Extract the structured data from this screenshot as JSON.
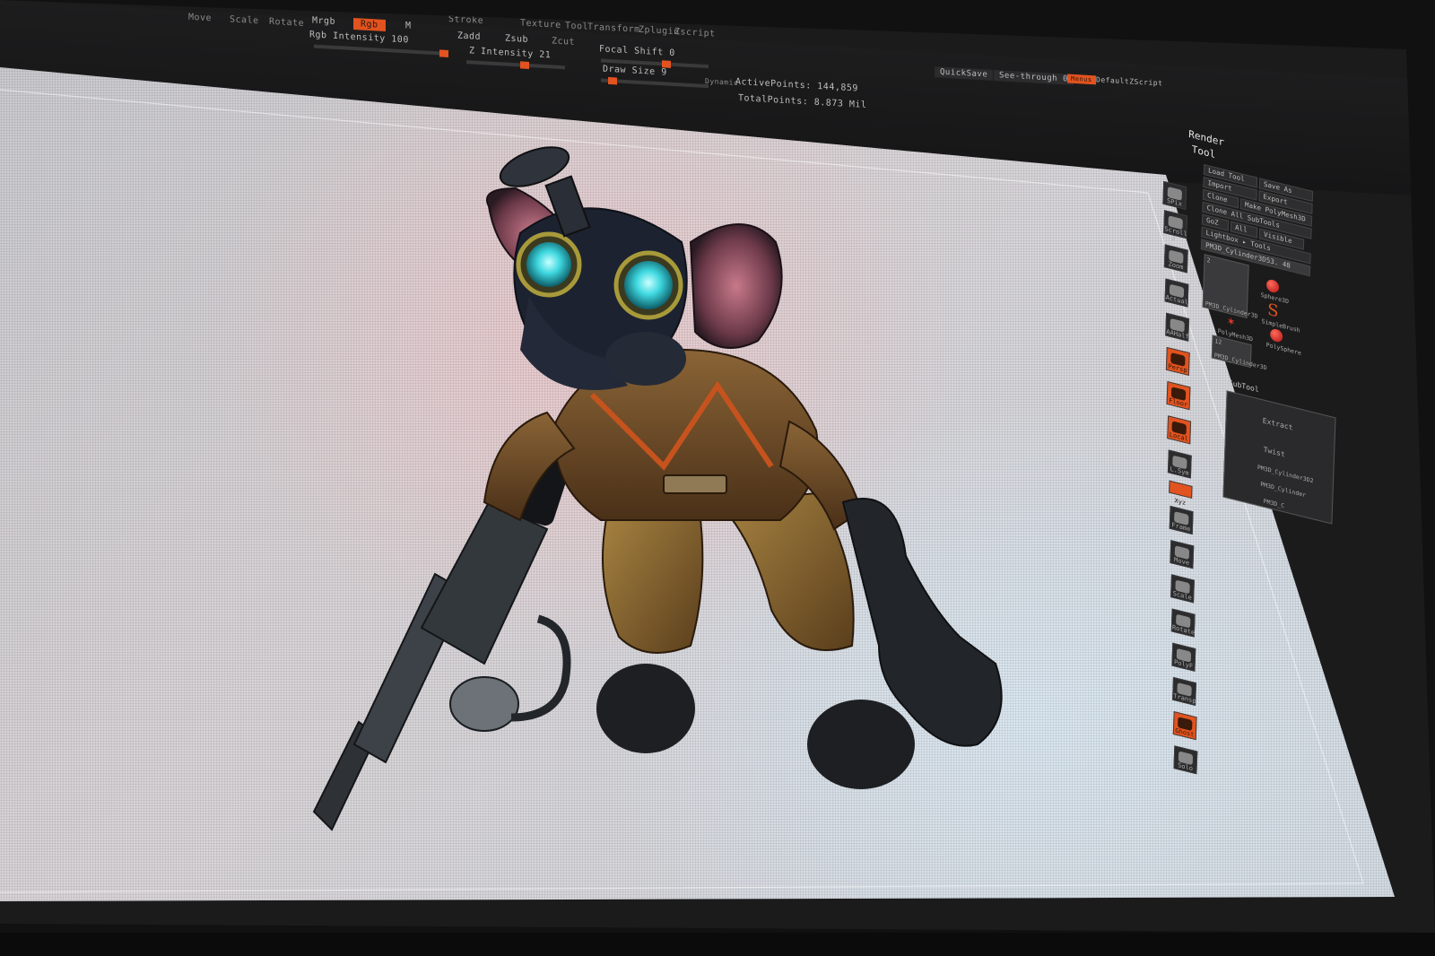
{
  "toolbar": {
    "row1": [
      "Move",
      "Scale",
      "Rotate",
      "Mrgb",
      "Rgb",
      "M"
    ],
    "rgb_intensity": "Rgb Intensity 100",
    "menus": [
      "Stroke",
      "Texture",
      "Tool",
      "Transform",
      "Zplugin",
      "Zscript"
    ],
    "zadd": "Zadd",
    "zsub": "Zsub",
    "zcut": "Zcut",
    "z_intensity": "Z Intensity 21",
    "focal_shift": "Focal Shift 0",
    "draw_size": "Draw Size 9",
    "dynamic": "Dynamic",
    "active_points": "ActivePoints: 144,859",
    "total_points": "TotalPoints: 8.873 Mil",
    "quicksave": "QuickSave",
    "see_through": "See-through 0",
    "menus_btn": "Menus",
    "default_zscript": "DefaultZScript"
  },
  "shelf": [
    {
      "label": "SPix 3",
      "icon": "bpr-sphere-icon",
      "active": false
    },
    {
      "label": "Scroll",
      "icon": "scroll-icon",
      "active": false
    },
    {
      "label": "Zoom",
      "icon": "zoom-icon",
      "active": false
    },
    {
      "label": "Actual",
      "icon": "actual-icon",
      "active": false
    },
    {
      "label": "AAHalf",
      "icon": "aahalf-icon",
      "active": false
    },
    {
      "label": "Persp",
      "icon": "perspective-icon",
      "active": true
    },
    {
      "label": "Floor",
      "icon": "floor-icon",
      "active": true
    },
    {
      "label": "Local",
      "icon": "local-icon",
      "active": true
    },
    {
      "label": "L.Sym",
      "icon": "local-symmetry-icon",
      "active": false
    },
    {
      "label": "Xyz",
      "icon": "xyz-icon",
      "active": true
    },
    {
      "label": "Frame",
      "icon": "frame-icon",
      "active": false
    },
    {
      "label": "Move",
      "icon": "move-icon",
      "active": false
    },
    {
      "label": "Scale",
      "icon": "scale-icon",
      "active": false
    },
    {
      "label": "Rotate",
      "icon": "rotate-icon",
      "active": false
    },
    {
      "label": "PolyF",
      "icon": "polyframe-icon",
      "active": false
    },
    {
      "label": "Transp",
      "icon": "transparency-icon",
      "active": false
    },
    {
      "label": "Ghost",
      "icon": "ghost-icon",
      "active": false
    },
    {
      "label": "Solo",
      "icon": "solo-icon",
      "active": false
    }
  ],
  "tool_palette": {
    "render_title": "Render",
    "tool_title": "Tool",
    "load_tool": "Load Tool",
    "save_as": "Save As",
    "import": "Import",
    "export": "Export",
    "clone": "Clone",
    "make_polymesh": "Make PolyMesh3D",
    "clone_all": "Clone All SubTools",
    "goz": "GoZ",
    "all": "All",
    "visible": "Visible",
    "lightbox_tools": "Lightbox ▸ Tools",
    "current_tool": "PM3D_Cylinder3D53. 48",
    "tool_count": "2",
    "tool_count_2": "12",
    "tools": [
      "PM3D_Cylinder3D",
      "Sphere3D",
      "SimpleBrush",
      "PolyMesh3D",
      "PolySphere",
      "PM3D_Cylinder3D"
    ],
    "subtool_title": "SubTool",
    "extract": "Extract",
    "twist": "Twist",
    "subtools": [
      "PM3D_Cylinder3D2",
      "PM3D_Cylinder",
      "PM3D_C"
    ]
  },
  "colors": {
    "accent": "#e2531f",
    "panel": "#1d1d1e"
  }
}
